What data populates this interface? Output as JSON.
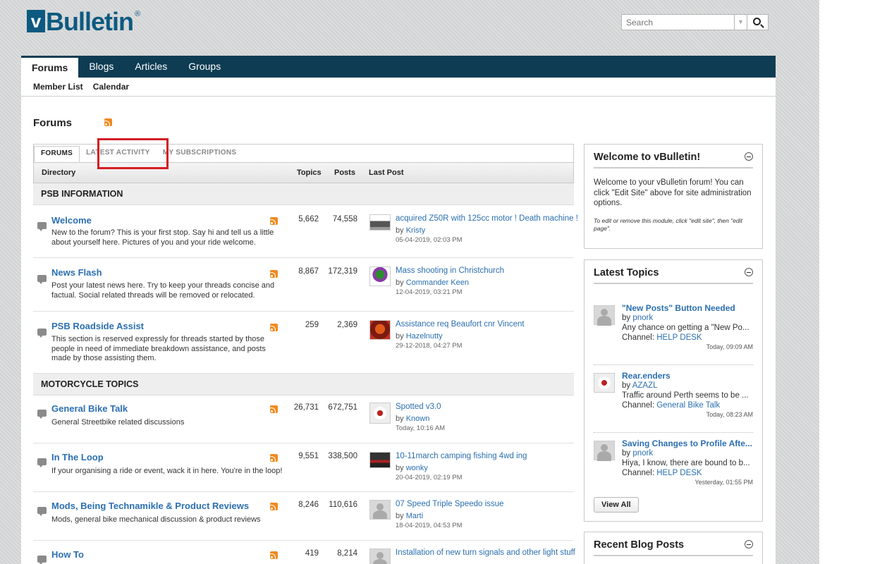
{
  "logo": {
    "v": "v",
    "text": "Bulletin",
    "reg": "®"
  },
  "search": {
    "placeholder": "Search"
  },
  "nav": {
    "tabs": [
      "Forums",
      "Blogs",
      "Articles",
      "Groups"
    ]
  },
  "subnav": [
    "Member List",
    "Calendar"
  ],
  "page_title": "Forums",
  "tabs": [
    "FORUMS",
    "LATEST ACTIVITY",
    "MY SUBSCRIPTIONS"
  ],
  "table_headers": {
    "directory": "Directory",
    "topics": "Topics",
    "posts": "Posts",
    "last_post": "Last Post"
  },
  "categories": [
    {
      "name": "PSB INFORMATION",
      "forums": [
        {
          "name": "Welcome",
          "desc": "New to the forum? This is your first stop. Say hi and tell us a little about yourself here. Pictures of you and your ride welcome.",
          "topics": "5,662",
          "posts": "74,558",
          "lp_title": "acquired Z50R with 125cc motor ! Death machine !",
          "lp_by": "by ",
          "lp_user": "Kristy",
          "lp_date": "05-04-2019, 02:03 PM"
        },
        {
          "name": "News Flash",
          "desc": "Post your latest news here. Try to keep your threads concise and factual. Social related threads will be removed or relocated.",
          "topics": "8,867",
          "posts": "172,319",
          "lp_title": "Mass shooting in Christchurch",
          "lp_by": "by ",
          "lp_user": "Commander Keen",
          "lp_date": "12-04-2019, 03:21 PM"
        },
        {
          "name": "PSB Roadside Assist",
          "desc": "This section is reserved expressly for threads started by those people in need of immediate breakdown assistance, and posts made by those assisting them.",
          "topics": "259",
          "posts": "2,369",
          "lp_title": "Assistance req Beaufort cnr Vincent",
          "lp_by": "by ",
          "lp_user": "Hazelnutty",
          "lp_date": "29-12-2018, 04:27 PM"
        }
      ]
    },
    {
      "name": "MOTORCYCLE TOPICS",
      "forums": [
        {
          "name": "General Bike Talk",
          "desc": "General Streetbike related discussions",
          "topics": "26,731",
          "posts": "672,751",
          "lp_title": "Spotted v3.0",
          "lp_by": "by ",
          "lp_user": "Known",
          "lp_date": "Today, 10:16 AM"
        },
        {
          "name": "In The Loop",
          "desc": "If your organising a ride or event, wack it in here. You're in the loop!",
          "topics": "9,551",
          "posts": "338,500",
          "lp_title": "10-11march camping fishing 4wd ing",
          "lp_by": "by ",
          "lp_user": "wonky",
          "lp_date": "20-04-2019, 02:19 PM"
        },
        {
          "name": "Mods, Being Technamikle & Product Reviews",
          "desc": "Mods, general bike mechanical discussion & product reviews",
          "topics": "8,246",
          "posts": "110,616",
          "lp_title": "07 Speed Triple Speedo issue",
          "lp_by": "by ",
          "lp_user": "Marti",
          "lp_date": "18-04-2019, 04:53 PM"
        },
        {
          "name": "How To",
          "desc": "",
          "topics": "419",
          "posts": "8,214",
          "lp_title": "Installation of new turn signals and other light stuff",
          "lp_by": "",
          "lp_user": "",
          "lp_date": ""
        }
      ]
    }
  ],
  "sidebar": {
    "welcome": {
      "title": "Welcome to vBulletin!",
      "text": "Welcome to your vBulletin forum! You can click \"Edit Site\" above for site administration options.",
      "note": "To edit or remove this module, click \"edit site\", then \"edit page\"."
    },
    "latest_topics": {
      "title": "Latest Topics",
      "items": [
        {
          "title": "\"New Posts\" Button Needed",
          "by": "by ",
          "user": "pnork",
          "excerpt": "Any chance on getting a \"New Po...",
          "channel_label": "Channel: ",
          "channel": "HELP DESK",
          "date": "Today, 09:09 AM"
        },
        {
          "title": "Rear.enders",
          "by": "by ",
          "user": "AZAZL",
          "excerpt": "Traffic around Perth seems to be ...",
          "channel_label": "Channel: ",
          "channel": "General Bike Talk",
          "date": "Today, 08:23 AM"
        },
        {
          "title": "Saving Changes to Profile Afte...",
          "by": "by ",
          "user": "pnork",
          "excerpt": "Hiya, I know, there are bound to b...",
          "channel_label": "Channel: ",
          "channel": "HELP DESK",
          "date": "Yesterday, 01:55 PM"
        }
      ],
      "view_all": "View All"
    },
    "recent_blog": {
      "title": "Recent Blog Posts"
    }
  }
}
